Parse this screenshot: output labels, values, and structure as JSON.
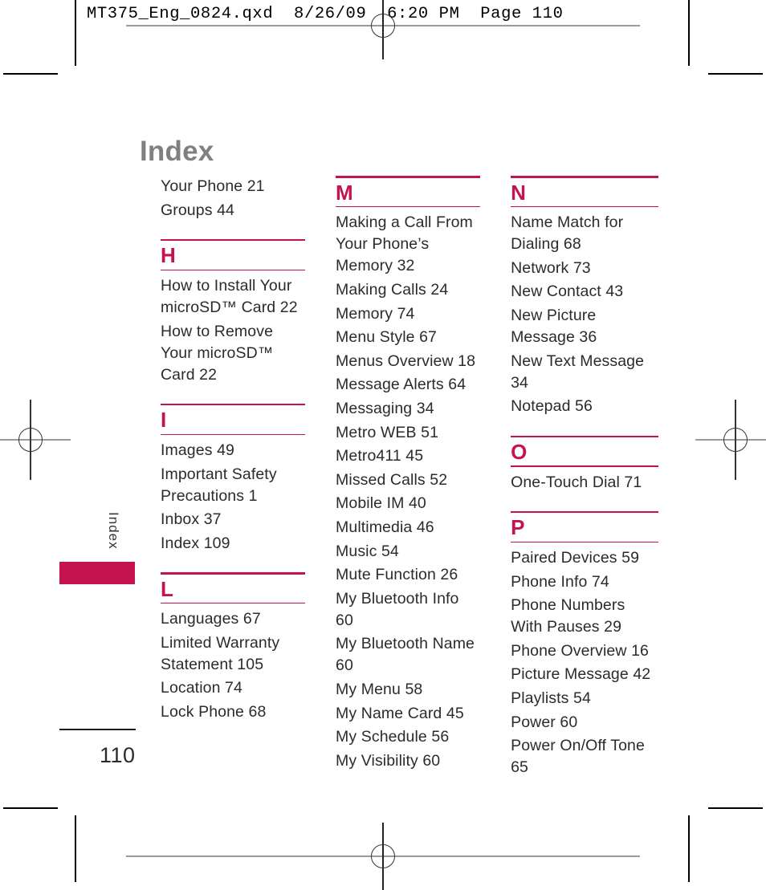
{
  "print_header": "MT375_Eng_0824.qxd  8/26/09  6:20 PM  Page 110",
  "page": {
    "title": "Index",
    "number": "110",
    "side_tab_label": "Index",
    "accent_color": "#c4134e",
    "title_color": "#808080"
  },
  "columns": [
    {
      "id": "column-1",
      "leading_entries": [
        "Your Phone 21",
        "Groups 44"
      ],
      "sections": [
        {
          "letter": "H",
          "entries": [
            "How to Install Your microSD™ Card 22",
            "How to Remove Your microSD™ Card 22"
          ]
        },
        {
          "letter": "I",
          "entries": [
            "Images 49",
            "Important Safety Precautions 1",
            "Inbox 37",
            "Index 109"
          ]
        },
        {
          "letter": "L",
          "entries": [
            "Languages 67",
            "Limited Warranty Statement 105",
            "Location 74",
            "Lock Phone 68"
          ]
        }
      ]
    },
    {
      "id": "column-2",
      "leading_entries": [],
      "sections": [
        {
          "letter": "M",
          "entries": [
            "Making a Call From Your Phone’s Memory 32",
            "Making Calls 24",
            "Memory 74",
            "Menu Style 67",
            "Menus Overview 18",
            "Message Alerts 64",
            "Messaging 34",
            "Metro WEB 51",
            "Metro411  45",
            "Missed Calls 52",
            "Mobile IM 40",
            "Multimedia 46",
            "Music 54",
            "Mute Function 26",
            "My Bluetooth Info 60",
            "My Bluetooth Name 60",
            "My Menu 58",
            "My Name Card 45",
            "My Schedule 56",
            "My Visibility 60"
          ]
        }
      ]
    },
    {
      "id": "column-3",
      "leading_entries": [],
      "sections": [
        {
          "letter": "N",
          "entries": [
            "Name Match for Dialing 68",
            "Network 73",
            "New Contact 43",
            "New Picture Message 36",
            "New Text Message 34",
            "Notepad 56"
          ]
        },
        {
          "letter": "O",
          "entries": [
            "One-Touch Dial 71"
          ]
        },
        {
          "letter": "P",
          "entries": [
            "Paired Devices 59",
            "Phone Info 74",
            "Phone Numbers With Pauses 29",
            "Phone Overview 16",
            "Picture Message 42",
            "Playlists 54",
            "Power 60",
            "Power On/Off Tone 65"
          ]
        }
      ]
    }
  ]
}
